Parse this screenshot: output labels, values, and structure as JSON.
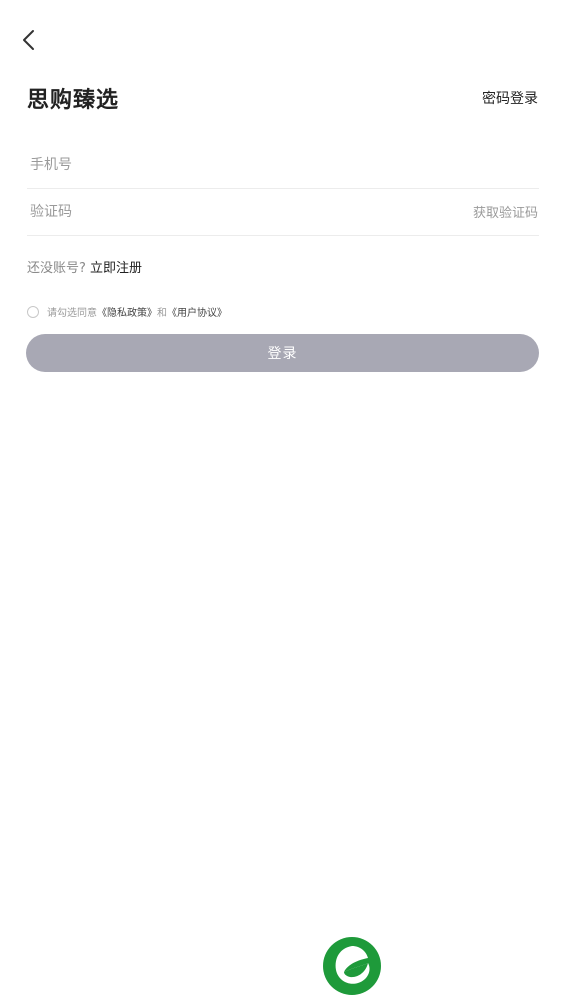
{
  "header": {
    "back_icon": "chevron-left-icon",
    "title": "思购臻选",
    "switch_mode_label": "密码登录"
  },
  "form": {
    "phone_placeholder": "手机号",
    "phone_value": "",
    "code_placeholder": "验证码",
    "code_value": "",
    "get_code_label": "获取验证码"
  },
  "register": {
    "prompt": "还没账号?",
    "link_label": "立即注册"
  },
  "agreement": {
    "prefix": "请勾选同意",
    "privacy_label": "《隐私政策》",
    "conjunction": "和",
    "terms_label": "《用户协议》",
    "checked": false
  },
  "login_button_label": "登录",
  "colors": {
    "button_disabled": "#a8a8b4",
    "logo_green": "#1e9a3a",
    "placeholder": "#9a9a9a"
  },
  "logo_icon": "leaf-logo-icon"
}
